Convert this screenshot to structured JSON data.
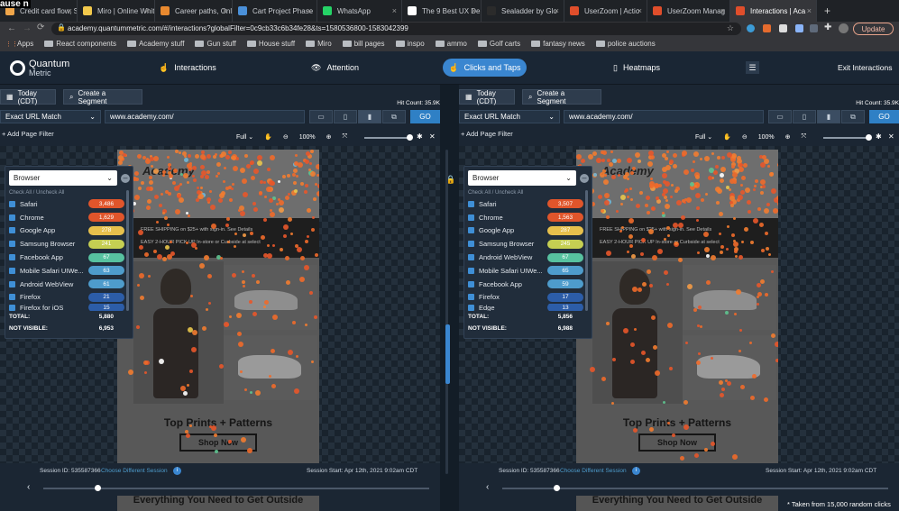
{
  "overlay_text": "ause n",
  "browser": {
    "tabs": [
      {
        "label": "Credit card flow, S",
        "color": "#f0a64a"
      },
      {
        "label": "Miro | Online Whit",
        "color": "#f2c94c"
      },
      {
        "label": "Career paths, Onl",
        "color": "#e8892f"
      },
      {
        "label": "Cart Project Phase",
        "color": "#4a90d9"
      },
      {
        "label": "WhatsApp",
        "color": "#25d366"
      },
      {
        "label": "The 9 Best UX De",
        "color": "#ffffff"
      },
      {
        "label": "Sealadder by Glo",
        "color": "#2b2b2b"
      },
      {
        "label": "UserZoom | Actio",
        "color": "#e04e2b"
      },
      {
        "label": "UserZoom Manag",
        "color": "#e04e2b"
      },
      {
        "label": "Interactions | Aca",
        "color": "#e04e2b"
      }
    ],
    "new_tab": "+",
    "url": "academy.quantummetric.com/#/interactions?globalFilter=0c9cb33c6b34fe28&ts=1580536800-1583042399",
    "update_label": "Update",
    "bookmarks": [
      "Apps",
      "React components",
      "Academy stuff",
      "Gun stuff",
      "House stuff",
      "Miro",
      "bill pages",
      "inspo",
      "ammo",
      "Golf carts",
      "fantasy news",
      "police auctions"
    ]
  },
  "app": {
    "logo_line1": "Quantum",
    "logo_line2": "Metric",
    "nav": {
      "interactions": "Interactions",
      "attention": "Attention",
      "clicks_taps": "Clicks and Taps",
      "heatmaps": "Heatmaps",
      "exit": "Exit Interactions"
    }
  },
  "panes": [
    {
      "today_label": "Today (CDT)",
      "segment_label": "Create a Segment",
      "hit_count": "Hit Count: 35.9K",
      "match_type": "Exact URL Match",
      "url": "www.academy.com/",
      "go_label": "GO",
      "add_filter": "+ Add Page Filter",
      "view_mode": "Full",
      "zoom": "100%",
      "browser_select": "Browser",
      "check_all": "Check All / Uncheck All",
      "browsers": [
        {
          "name": "Safari",
          "count": "3,486",
          "color": "#e0552b"
        },
        {
          "name": "Chrome",
          "count": "1,629",
          "color": "#e0552b"
        },
        {
          "name": "Google App",
          "count": "278",
          "color": "#e7c04c"
        },
        {
          "name": "Samsung Browser",
          "count": "241",
          "color": "#c5cf52"
        },
        {
          "name": "Facebook App",
          "count": "67",
          "color": "#57c2a0"
        },
        {
          "name": "Mobile Safari UIWe...",
          "count": "63",
          "color": "#4e9ccc"
        },
        {
          "name": "Android WebView",
          "count": "61",
          "color": "#4e9ccc"
        },
        {
          "name": "Firefox",
          "count": "21",
          "color": "#2c5da8"
        },
        {
          "name": "Firefox for iOS",
          "count": "15",
          "color": "#2c5da8"
        }
      ],
      "total_label": "TOTAL:",
      "total_value": "5,880",
      "not_visible_label": "NOT VISIBLE:",
      "not_visible_value": "6,953",
      "site": {
        "logo": "Academy",
        "promo1": "FREE SHIPPING on $25+ with sign-in. See Details",
        "promo2": "EASY 2-HOUR PICK UP In-store or Curbside at select",
        "headline": "Top Prints + Patterns",
        "cta": "Shop Now",
        "next_headline": "Everything You Need to Get Outside"
      },
      "session_id": "Session ID: 535587366",
      "choose_session": "Choose Different Session",
      "session_start": "Session Start:  Apr 12th, 2021 9:02am CDT",
      "timeline_position": 0.14
    },
    {
      "today_label": "Today (CDT)",
      "segment_label": "Create a Segment",
      "hit_count": "Hit Count: 35.9K",
      "match_type": "Exact URL Match",
      "url": "www.academy.com/",
      "go_label": "GO",
      "add_filter": "+ Add Page Filter",
      "view_mode": "Full",
      "zoom": "100%",
      "browser_select": "Browser",
      "check_all": "Check All / Uncheck All",
      "browsers": [
        {
          "name": "Safari",
          "count": "3,507",
          "color": "#e0552b"
        },
        {
          "name": "Chrome",
          "count": "1,563",
          "color": "#e0552b"
        },
        {
          "name": "Google App",
          "count": "287",
          "color": "#e7c04c"
        },
        {
          "name": "Samsung Browser",
          "count": "245",
          "color": "#c5cf52"
        },
        {
          "name": "Android WebView",
          "count": "67",
          "color": "#57c2a0"
        },
        {
          "name": "Mobile Safari UIWe...",
          "count": "65",
          "color": "#4e9ccc"
        },
        {
          "name": "Facebook App",
          "count": "59",
          "color": "#4e9ccc"
        },
        {
          "name": "Firefox",
          "count": "17",
          "color": "#2c5da8"
        },
        {
          "name": "Edge",
          "count": "13",
          "color": "#2c5da8"
        }
      ],
      "total_label": "TOTAL:",
      "total_value": "5,856",
      "not_visible_label": "NOT VISIBLE:",
      "not_visible_value": "6,988",
      "site": {
        "logo": "Academy",
        "promo1": "FREE SHIPPING on $25+ with sign-in. See Details",
        "promo2": "EASY 2-HOUR PICK UP In-store or Curbside at select",
        "headline": "Top Prints + Patterns",
        "cta": "Shop Now",
        "next_headline": "Everything You Need to Get Outside"
      },
      "session_id": "Session ID: 535587366",
      "choose_session": "Choose Different Session",
      "session_start": "Session Start:  Apr 12th, 2021 9:02am CDT",
      "timeline_position": 0.14,
      "footnote": "Taken from 15,000 random clicks"
    }
  ]
}
